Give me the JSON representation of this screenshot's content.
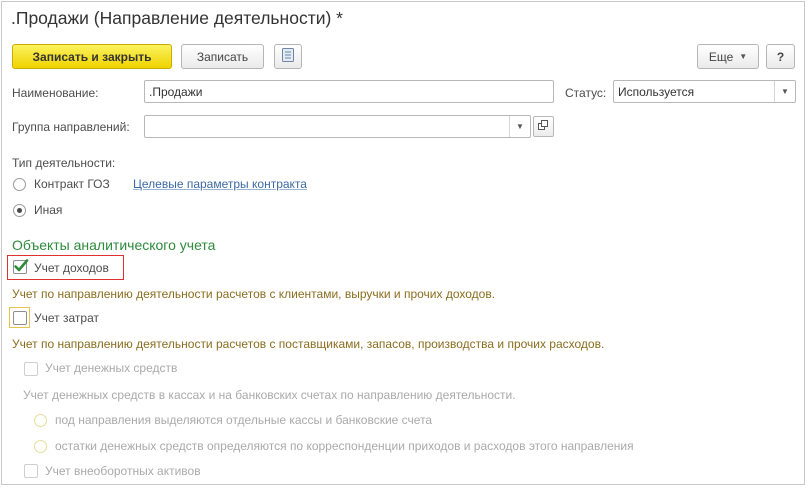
{
  "header": {
    "title": ".Продажи (Направление деятельности) *"
  },
  "toolbar": {
    "save_close_label": "Записать и закрыть",
    "save_label": "Записать",
    "more_label": "Еще",
    "help_label": "?"
  },
  "fields": {
    "name_label": "Наименование:",
    "name_value": ".Продажи",
    "status_label": "Статус:",
    "status_value": "Используется",
    "group_label": "Группа направлений:",
    "group_value": ""
  },
  "activity": {
    "label": "Тип деятельности:",
    "option_goz": "Контракт ГОЗ",
    "contract_link": "Целевые параметры контракта",
    "option_other": "Иная",
    "selected": "Иная"
  },
  "analytics": {
    "section_title": "Объекты аналитического учета",
    "income_label": "Учет доходов",
    "income_checked": true,
    "income_hint": "Учет по направлению деятельности расчетов с клиентами, выручки и прочих доходов.",
    "costs_label": "Учет затрат",
    "costs_checked": false,
    "costs_hint": "Учет по направлению деятельности расчетов с поставщиками, запасов, производства и прочих расходов.",
    "cash_label": "Учет денежных средств",
    "cash_hint": "Учет денежных средств в кассах и на банковских счетах по направлению деятельности.",
    "cash_option1": "под направления выделяются отдельные кассы и банковские счета",
    "cash_option2": "остатки денежных средств определяются по корреспонденции приходов и расходов этого направления",
    "assets_label": "Учет внеоборотных активов"
  },
  "colors": {
    "primary_button": "#f5e21a",
    "section_title": "#2e8b3c",
    "hint_text": "#8b6d1f",
    "link": "#3d6aa3",
    "highlight_red": "#e03030",
    "highlight_yellow": "#e6c34a",
    "checkmark": "#2f8a3a"
  },
  "icons": {
    "report": "list-report-icon",
    "dropdown": "chevron-down-icon",
    "open": "open-form-icon",
    "check": "checkmark-icon"
  }
}
